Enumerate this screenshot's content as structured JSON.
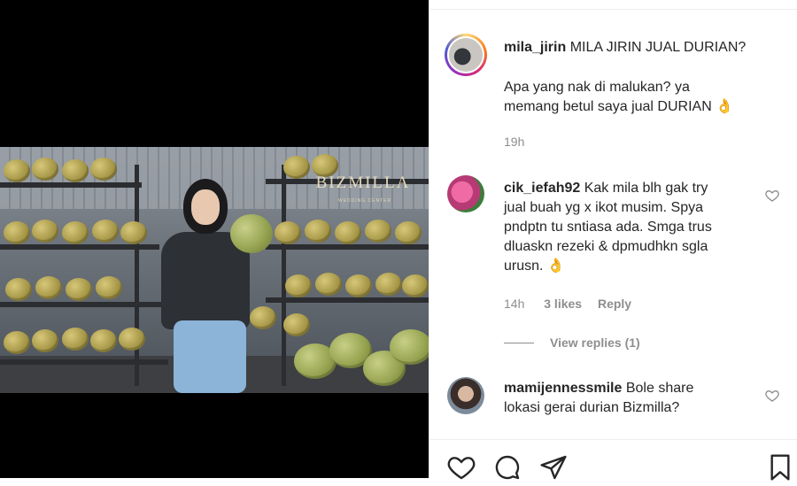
{
  "post": {
    "author": "mila_jirin",
    "caption_line1": "MILA JIRIN JUAL DURIAN?",
    "caption_line2": "Apa yang nak di malukan? ya",
    "caption_line3": "memang betul saya jual DURIAN 👌",
    "time": "19h"
  },
  "media": {
    "logo_text": "BIZMILLA",
    "logo_subtext": "WEDDING CENTER"
  },
  "comments": [
    {
      "username": "cik_iefah92",
      "lines": [
        "Kak mila blh gak try",
        "jual buah yg x ikot musim. Spya",
        "pndptn tu sntiasa ada. Smga trus",
        "dluaskn rezeki & dpmudhkn sgla",
        "urusn. 👌"
      ],
      "time": "14h",
      "likes": "3 likes",
      "reply_label": "Reply",
      "view_replies": "View replies (1)"
    },
    {
      "username": "mamijennessmile",
      "lines": [
        "Bole share",
        "lokasi gerai durian Bizmilla?"
      ]
    }
  ],
  "actions": [
    "heart-icon",
    "comment-icon",
    "share-icon",
    "bookmark-icon"
  ],
  "colors": {
    "text": "#262626",
    "muted": "#8e8e8e",
    "divider": "#efefef",
    "media_bg": "#000000"
  }
}
